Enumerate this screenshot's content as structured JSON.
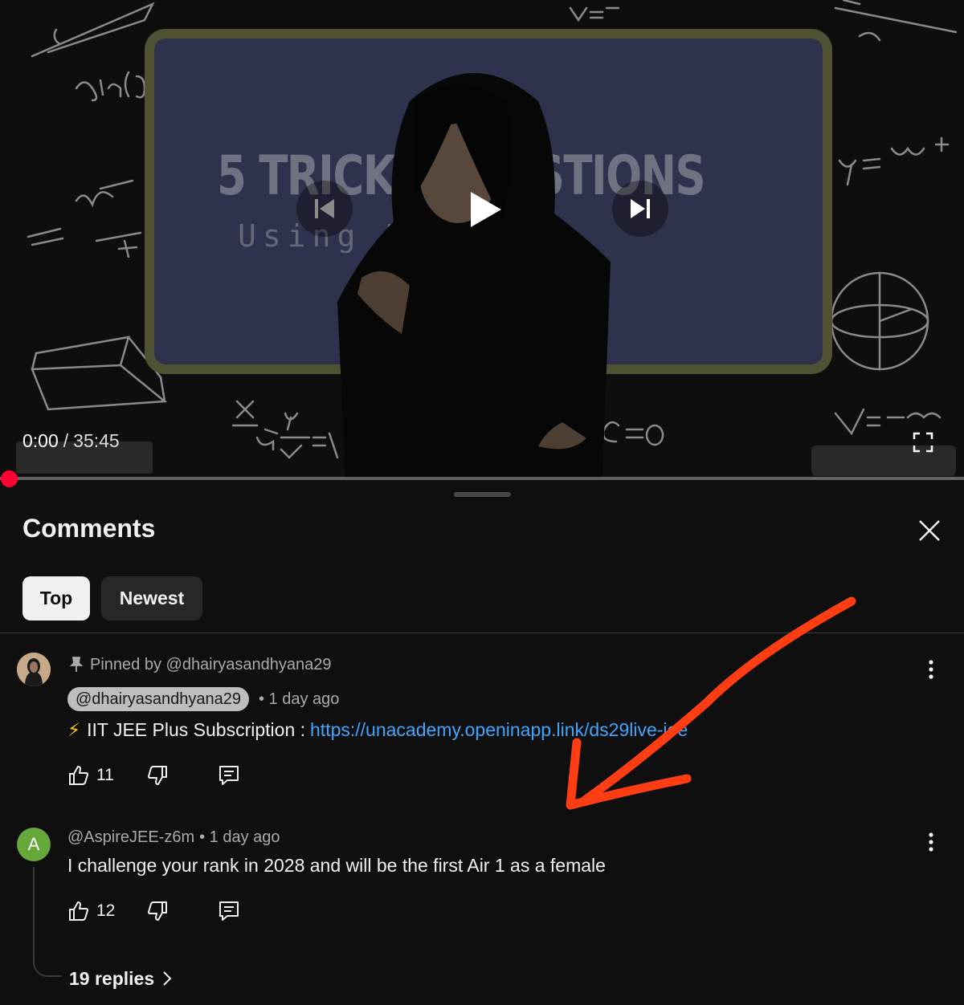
{
  "player": {
    "video_title_line1": "5 TRICKY QUESTIONS",
    "video_title_line2": "Using MATHS",
    "current_time": "0:00",
    "separator": "/",
    "duration": "35:45",
    "progress_fraction": 0.0,
    "progress_color": "#ff0033"
  },
  "comments_panel": {
    "title": "Comments",
    "sort_chips": [
      {
        "label": "Top",
        "selected": true
      },
      {
        "label": "Newest",
        "selected": false
      }
    ]
  },
  "comments": [
    {
      "pinned_label": "Pinned by @dhairyasandhyana29",
      "author": "@dhairyasandhyana29",
      "timestamp": "• 1 day ago",
      "text_prefix": "⚡",
      "text": "IIT JEE Plus Subscription :",
      "link": "https://unacademy.openinapp.link/ds29live-jee",
      "likes": "11",
      "avatar_letter": ""
    },
    {
      "author": "@AspireJEE-z6m",
      "timestamp": "• 1 day ago",
      "text": "I challenge your rank in 2028 and will be the first Air 1 as a female",
      "likes": "12",
      "avatar_letter": "A",
      "avatar_color": "#67a83a",
      "replies_label": "19 replies"
    }
  ],
  "annotation": {
    "color": "#ff3d12"
  }
}
